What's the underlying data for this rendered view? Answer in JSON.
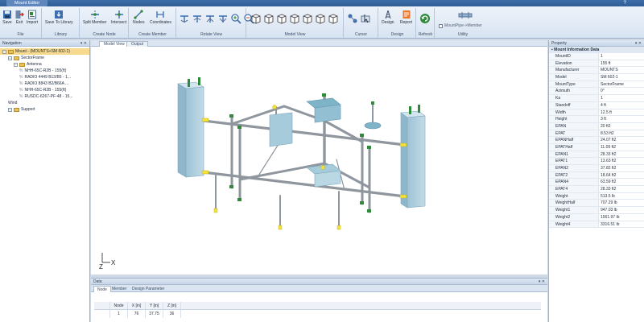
{
  "window": {
    "title": "Mount Editor"
  },
  "ribbon": {
    "groups": {
      "file": "File",
      "library": "Library",
      "create_node": "Create Node",
      "create_member": "Create Member",
      "rotate_view": "Rotate View",
      "model_view": "Model View",
      "cursor": "Cursor",
      "design": "Design",
      "refresh": "Refresh",
      "utility": "Utility"
    },
    "buttons": {
      "save": "Save",
      "exit": "Exit",
      "import": "Import",
      "save_to_library": "Save To Library",
      "split_member": "Split Member",
      "intersect": "Intersect",
      "nodes": "Nodes",
      "coordinates": "Coordinates",
      "design": "Design",
      "report": "Report",
      "mount_pipe": "MountPipe->Member"
    }
  },
  "navigation": {
    "title": "Navigation",
    "tree": [
      {
        "label": "Mount - (MOUNTS+SM 602-1)",
        "indent": 0,
        "kind": "root",
        "selected": true
      },
      {
        "label": "SectorFrame",
        "indent": 1,
        "kind": "folder"
      },
      {
        "label": "Antenna",
        "indent": 2,
        "kind": "folder"
      },
      {
        "label": "NHH-65C-R2B - 155(ft)",
        "indent": 3,
        "kind": "item"
      },
      {
        "label": "RADIO 4449 B13/B5 - 1...",
        "indent": 3,
        "kind": "item"
      },
      {
        "label": "RADIO 8843 B2/B66A ...",
        "indent": 3,
        "kind": "item"
      },
      {
        "label": "NHH-65C-R2B - 155(ft)",
        "indent": 3,
        "kind": "item"
      },
      {
        "label": "RUSDC-6267-PF-48 - 15...",
        "indent": 3,
        "kind": "item"
      },
      {
        "label": "Wind",
        "indent": 1,
        "kind": "plain"
      },
      {
        "label": "Support",
        "indent": 1,
        "kind": "folder"
      }
    ]
  },
  "view_tabs": {
    "model": "Model View",
    "output": "Output"
  },
  "axis": {
    "z": "Z",
    "x": "X"
  },
  "property": {
    "title": "Property",
    "section": "Mount Information Data",
    "rows": [
      {
        "key": "MountID",
        "value": "1"
      },
      {
        "key": "Elevation",
        "value": "155 ft"
      },
      {
        "key": "Manufacturer",
        "value": "MOUNTS"
      },
      {
        "key": "Model",
        "value": "SM 602-1"
      },
      {
        "key": "MountType",
        "value": "SectorFrame"
      },
      {
        "key": "Azimuth",
        "value": "0°"
      },
      {
        "key": "Ka",
        "value": "1"
      },
      {
        "key": "Standoff",
        "value": "4 ft"
      },
      {
        "key": "Width",
        "value": "12.5 ft"
      },
      {
        "key": "Height",
        "value": "3 ft"
      },
      {
        "key": "EPAN",
        "value": "20 ft2"
      },
      {
        "key": "EPAT",
        "value": "8.53 ft2"
      },
      {
        "key": "EPANHalf",
        "value": "24.07 ft2"
      },
      {
        "key": "EPATHalf",
        "value": "11.09 ft2"
      },
      {
        "key": "EPAN1",
        "value": "28.33 ft2"
      },
      {
        "key": "EPAT1",
        "value": "13.63 ft2"
      },
      {
        "key": "EPAN2",
        "value": "37.82 ft2"
      },
      {
        "key": "EPAT2",
        "value": "18.64 ft2"
      },
      {
        "key": "EPAN4",
        "value": "63.59 ft2"
      },
      {
        "key": "EPAT4",
        "value": "28.33 ft2"
      },
      {
        "key": "Weight",
        "value": "513.5 lb"
      },
      {
        "key": "WeightHalf",
        "value": "707.29 lb"
      },
      {
        "key": "Weight1",
        "value": "947.03 lb"
      },
      {
        "key": "Weight2",
        "value": "1561.97 lb"
      },
      {
        "key": "Weight4",
        "value": "3316.51 lb"
      }
    ]
  },
  "data_panel": {
    "title": "Data",
    "tabs": [
      "Node",
      "Member",
      "Design Parameter"
    ],
    "columns": [
      "Node",
      "X [in]",
      "Y [in]",
      "Z [in]"
    ],
    "rows": [
      {
        "node": "1",
        "x": "76",
        "y": "37.75",
        "z": "36"
      }
    ]
  },
  "colors": {
    "accent": "#2f5d94",
    "column": "#a9cbdc",
    "pipe": "#8f969e",
    "node": "#2e8b3a",
    "tip": "#f2e23a"
  }
}
